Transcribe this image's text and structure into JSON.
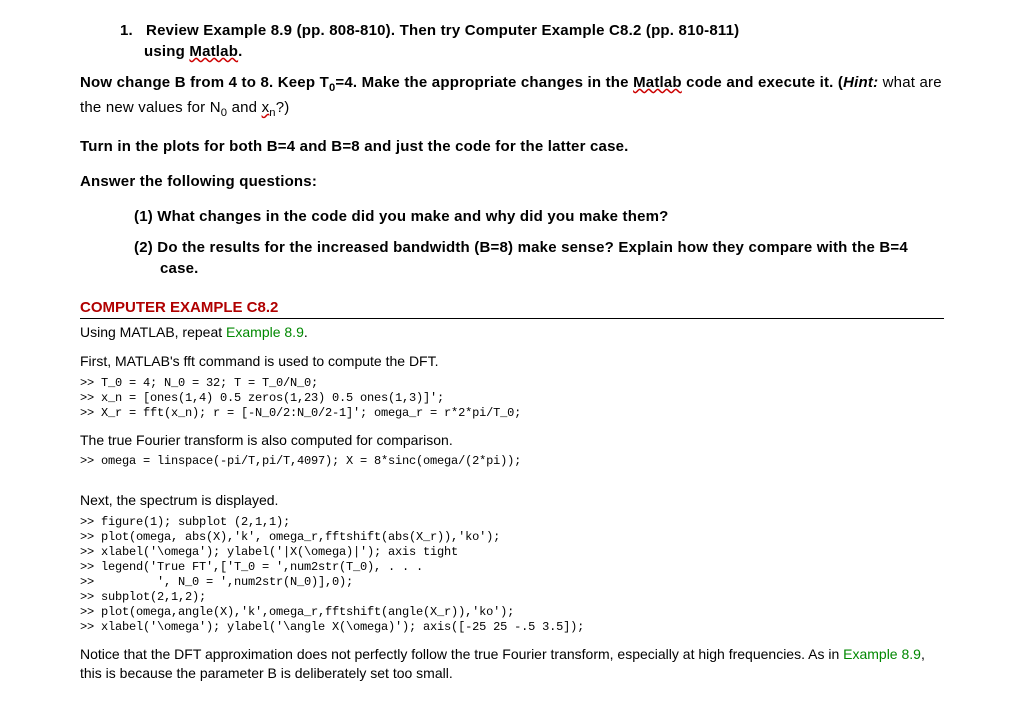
{
  "item1": {
    "num": "1.",
    "line1a": "Review Example 8.9 (pp. 808-810). Then try Computer Example C8.2 (pp. 810-811)",
    "line1b": "using ",
    "matlab": "Matlab",
    "dot": "."
  },
  "p2": {
    "a": "Now change B from 4 to 8. Keep T",
    "sub0": "0",
    "b": "=4. Make the appropriate changes in the ",
    "matlab": "Matlab",
    "c": " code and execute it. (",
    "hint": "Hint:",
    "d": " what are the new values for N",
    "sub02": "0",
    "e": " and ",
    "xn": "x",
    "xn_sub": "n",
    "f": "?)"
  },
  "p3": "Turn in the plots for both B=4 and B=8 and just the code for the latter case.",
  "p4": "Answer the following questions:",
  "q1": "(1) What changes in the code did you make and why did you make them?",
  "q2": "(2) Do the results for the increased bandwidth (B=8) make sense? Explain how they compare with the B=4 case.",
  "sectionHead": "COMPUTER EXAMPLE C8.2",
  "subline_a": "Using MATLAB, repeat ",
  "example89": "Example 8.9",
  "subline_b": ".",
  "text1": "First, MATLAB's fft command is used to compute the DFT.",
  "code1": ">> T_0 = 4; N_0 = 32; T = T_0/N_0;\n>> x_n = [ones(1,4) 0.5 zeros(1,23) 0.5 ones(1,3)]';\n>> X_r = fft(x_n); r = [-N_0/2:N_0/2-1]'; omega_r = r*2*pi/T_0;",
  "text2": "The true Fourier transform is also computed for comparison.",
  "code2": ">> omega = linspace(-pi/T,pi/T,4097); X = 8*sinc(omega/(2*pi));",
  "text3": "Next, the spectrum is displayed.",
  "code3": ">> figure(1); subplot (2,1,1);\n>> plot(omega, abs(X),'k', omega_r,fftshift(abs(X_r)),'ko');\n>> xlabel('\\omega'); ylabel('|X(\\omega)|'); axis tight\n>> legend('True FT',['T_0 = ',num2str(T_0), . . .\n>>         ', N_0 = ',num2str(N_0)],0);\n>> subplot(2,1,2);\n>> plot(omega,angle(X),'k',omega_r,fftshift(angle(X_r)),'ko');\n>> xlabel('\\omega'); ylabel('\\angle X(\\omega)'); axis([-25 25 -.5 3.5]);",
  "notice_a": "Notice that the DFT approximation does not perfectly follow the true Fourier transform, especially at high frequencies. As in ",
  "notice_ex": "Example 8.9",
  "notice_b": ", this is because the parameter B is deliberately set too small."
}
